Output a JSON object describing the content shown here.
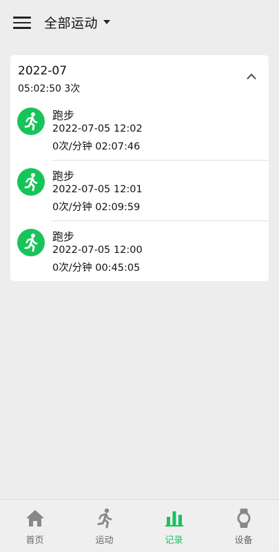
{
  "header": {
    "filter_label": "全部运动"
  },
  "summary": {
    "month": "2022-07",
    "stats": "05:02:50 3次"
  },
  "records": [
    {
      "type": "跑步",
      "datetime": "2022-07-05 12:02",
      "stats": "0次/分钟 02:07:46"
    },
    {
      "type": "跑步",
      "datetime": "2022-07-05 12:01",
      "stats": "0次/分钟 02:09:59"
    },
    {
      "type": "跑步",
      "datetime": "2022-07-05 12:00",
      "stats": "0次/分钟 00:45:05"
    }
  ],
  "tabs": [
    {
      "label": "首页",
      "icon": "home-icon",
      "active": false
    },
    {
      "label": "运动",
      "icon": "running-icon",
      "active": false
    },
    {
      "label": "记录",
      "icon": "bar-chart-icon",
      "active": true
    },
    {
      "label": "设备",
      "icon": "watch-icon",
      "active": false
    }
  ],
  "colors": {
    "accent": "#17c45a",
    "background": "#ededed",
    "card": "#ffffff",
    "inactive_tab": "#888888"
  }
}
